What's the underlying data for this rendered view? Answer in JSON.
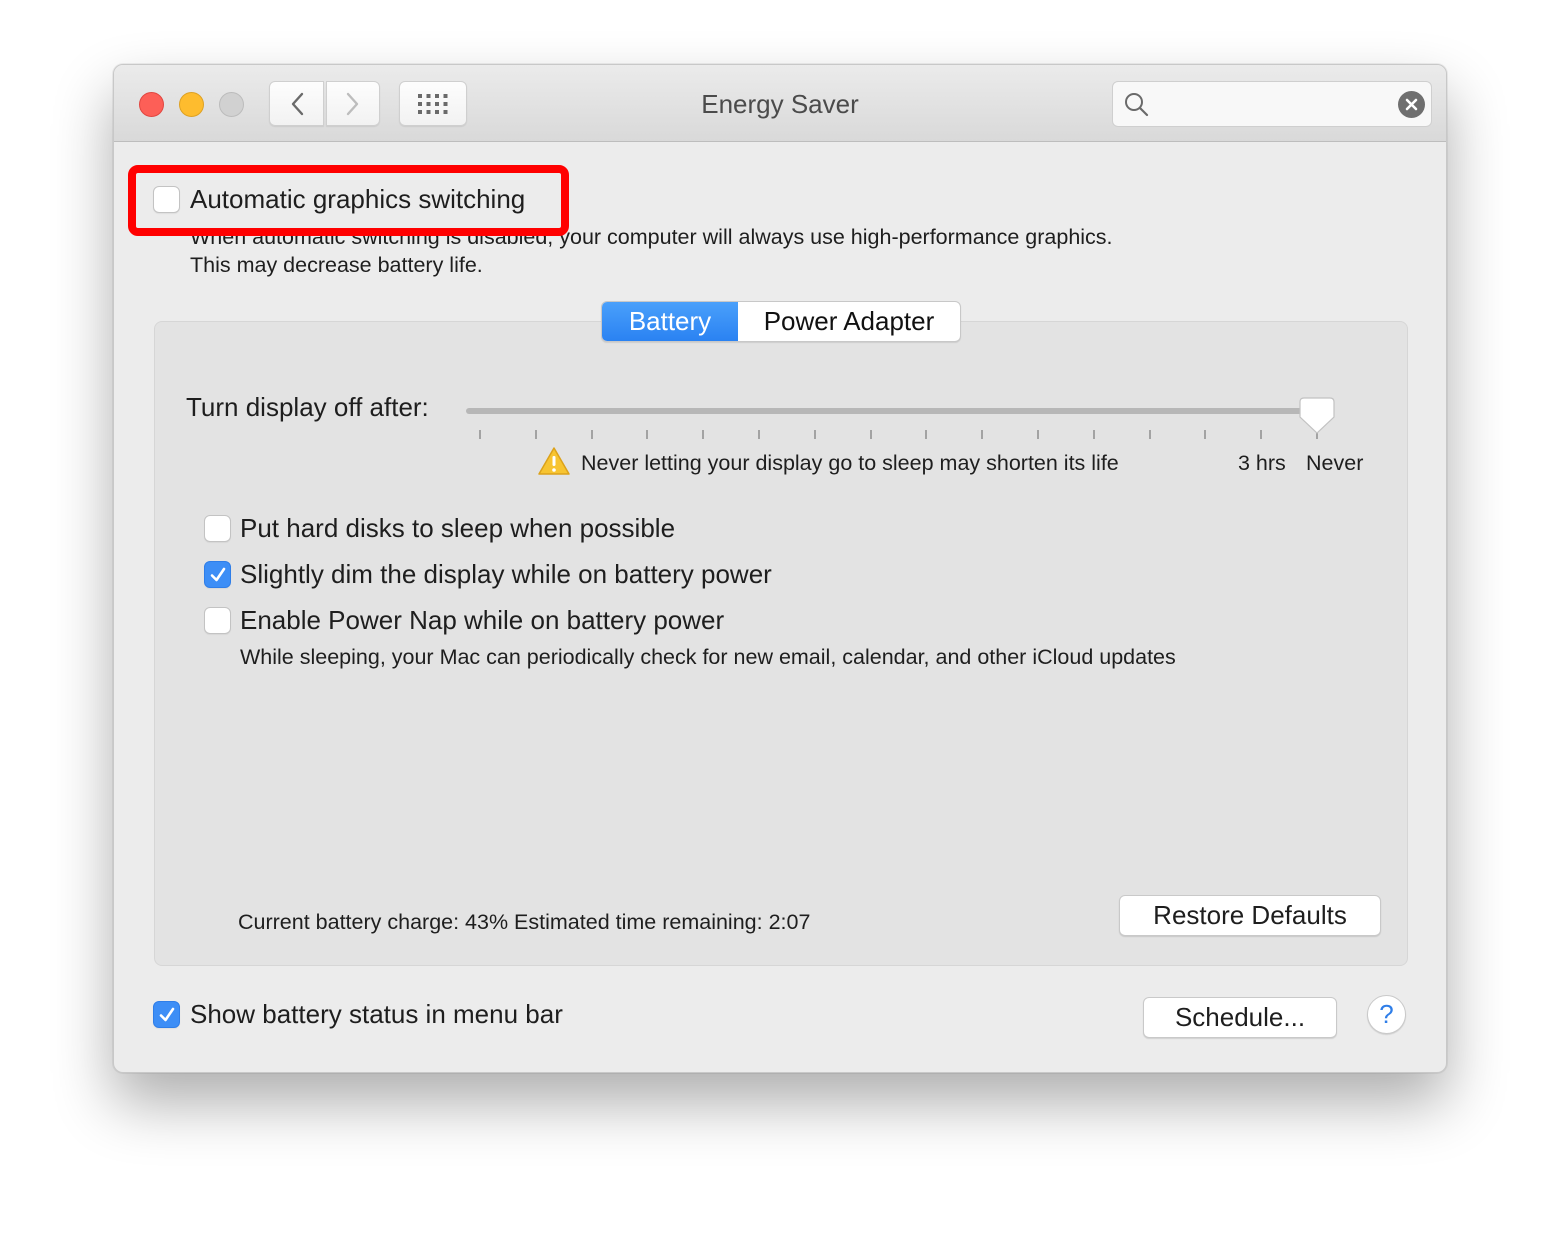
{
  "window": {
    "title": "Energy Saver",
    "search": {
      "value": "",
      "placeholder": ""
    }
  },
  "graphics": {
    "checkbox_label": "Automatic graphics switching",
    "checked": false,
    "description_line1": "When automatic switching is disabled, your computer will always use high-performance graphics.",
    "description_line2": "This may decrease battery life."
  },
  "tabs": [
    {
      "label": "Battery",
      "active": true
    },
    {
      "label": "Power Adapter",
      "active": false
    }
  ],
  "display_sleep": {
    "label": "Turn display off after:",
    "value": "Never",
    "tick_count": 16,
    "selected_tick_index": 15,
    "warning": "Never letting your display go to sleep may shorten its life",
    "tick_labels": [
      "3 hrs",
      "Never"
    ]
  },
  "options": [
    {
      "label": "Put hard disks to sleep when possible",
      "checked": false
    },
    {
      "label": "Slightly dim the display while on battery power",
      "checked": true
    },
    {
      "label": "Enable Power Nap while on battery power",
      "checked": false
    }
  ],
  "power_nap_description": "While sleeping, your Mac can periodically check for new email, calendar, and other iCloud updates",
  "battery_status": "Current battery charge: 43%  Estimated time remaining: 2:07",
  "buttons": {
    "restore_defaults": "Restore Defaults",
    "schedule": "Schedule...",
    "help": "?"
  },
  "menu_bar": {
    "label": "Show battery status in menu bar",
    "checked": true
  },
  "colors": {
    "accent": "#3d8ef6",
    "highlight": "#ff0000"
  }
}
